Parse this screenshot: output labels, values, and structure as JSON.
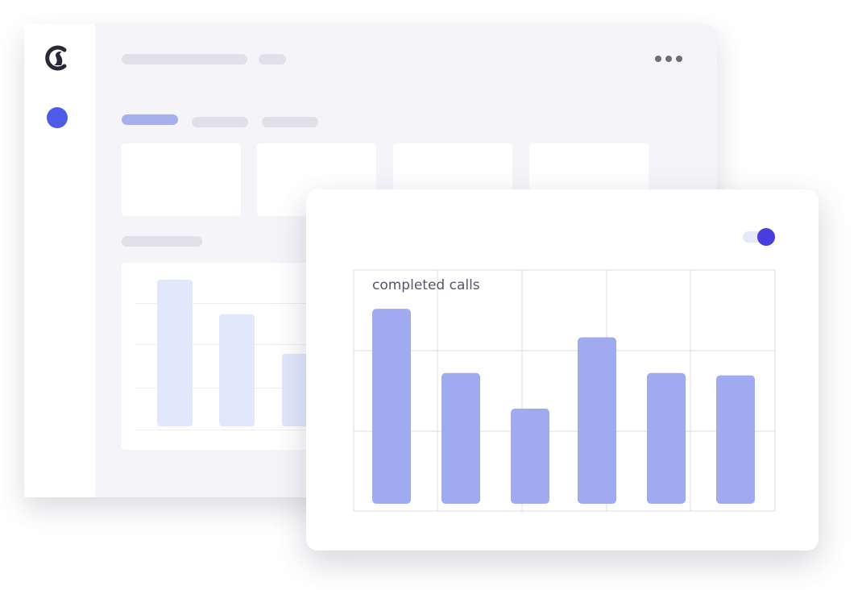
{
  "menu": {
    "icon": "more-horizontal-icon"
  },
  "sidebar": {
    "logo_icon": "brand-logo-icon",
    "active_item_icon": "nav-dot-icon"
  },
  "toggle": {
    "state": "on",
    "color": "#4a3de0"
  },
  "colors": {
    "accent": "#4f5be8",
    "bar": "#9faaf0",
    "background_bar": "#e1e8fb",
    "window_bg": "#f5f5f9"
  },
  "chart_data": {
    "type": "bar",
    "title": "completed calls",
    "categories": [
      "",
      "",
      "",
      "",
      "",
      ""
    ],
    "values": [
      82,
      55,
      40,
      70,
      55,
      54
    ],
    "ylim": [
      0,
      100
    ],
    "grid": true,
    "xlabel": "",
    "ylabel": ""
  },
  "background_chart": {
    "values": [
      85,
      65,
      42
    ]
  }
}
